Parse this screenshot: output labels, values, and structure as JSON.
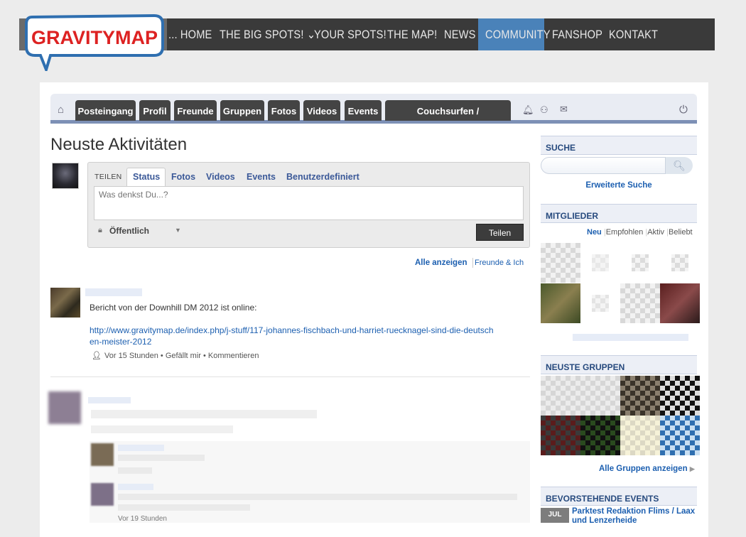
{
  "logo": {
    "text": "GRAVITYMAP"
  },
  "topnav": {
    "items": [
      {
        "label": "... HOME"
      },
      {
        "label": "THE BIG SPOTS!"
      },
      {
        "label": "YOUR SPOTS!"
      },
      {
        "label": "THE MAP!"
      },
      {
        "label": "NEWS"
      },
      {
        "label": "COMMUNITY"
      },
      {
        "label": "FANSHOP"
      },
      {
        "label": "KONTAKT"
      }
    ],
    "active": "COMMUNITY"
  },
  "tabbar": {
    "tabs": [
      {
        "label": "Posteingang"
      },
      {
        "label": "Profil"
      },
      {
        "label": "Freunde"
      },
      {
        "label": "Gruppen"
      },
      {
        "label": "Fotos"
      },
      {
        "label": "Videos"
      },
      {
        "label": "Events"
      },
      {
        "label": "Couchsurfen / Kleinanzeigen"
      }
    ]
  },
  "main": {
    "title": "Neuste Aktivitäten",
    "share": {
      "label": "TEILEN",
      "tabs": [
        "Status",
        "Fotos",
        "Videos",
        "Events",
        "Benutzerdefiniert"
      ],
      "placeholder": "Was denkst Du...?",
      "privacy": "Öffentlich",
      "button": "Teilen"
    },
    "filters": {
      "all": "Alle anzeigen",
      "friends": "Freunde & Ich"
    },
    "post": {
      "text": "Bericht von der Downhill DM 2012 ist online:",
      "link": "http://www.gravitymap.de/index.php/j-stuff/117-johannes-fischbach-und-harriet-ruecknagel-sind-die-deutschen-meister-2012",
      "meta_time": "Vor 15 Stunden",
      "meta_like": "Gefällt mir",
      "meta_comment": "Kommentieren"
    },
    "post2": {
      "comment_time": "Vor 19 Stunden"
    }
  },
  "sidebar": {
    "search": {
      "title": "SUCHE",
      "advanced": "Erweiterte Suche"
    },
    "members": {
      "title": "MITGLIEDER",
      "filters": [
        "Neu",
        "Empfohlen",
        "Aktiv",
        "Beliebt"
      ]
    },
    "groups": {
      "title": "NEUSTE GRUPPEN",
      "all": "Alle Gruppen anzeigen"
    },
    "events": {
      "title": "BEVORSTEHENDE EVENTS",
      "month": "JUL",
      "event_title": "Parktest Redaktion Flims / Laax und Lenzerheide"
    }
  }
}
